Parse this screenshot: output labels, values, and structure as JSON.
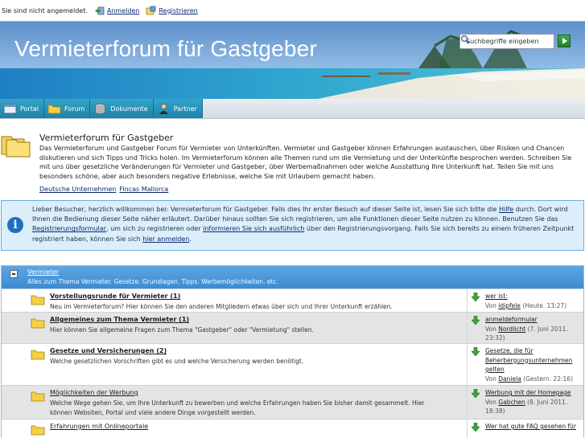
{
  "userbar": {
    "status": "Sie sind nicht angemeldet.",
    "login_label": "Anmelden",
    "register_label": "Registrieren"
  },
  "header": {
    "title": "Vermieterforum für Gastgeber",
    "search_placeholder": "Suchbegriffe eingeben"
  },
  "nav": {
    "tabs": [
      {
        "label": "Portal",
        "icon": "portal-icon"
      },
      {
        "label": "Forum",
        "icon": "folder-icon"
      },
      {
        "label": "Dokumente",
        "icon": "database-icon"
      },
      {
        "label": "Partner",
        "icon": "user-icon"
      }
    ]
  },
  "intro": {
    "title": "Vermieterforum für Gastgeber",
    "description": "Das Vermieterforum und Gastgeber Forum für Vermieter von Unterkünften. Vermieter und Gastgeber können Erfahrungen austauschen, über Risiken und Chancen diskutieren und sich Tipps und Tricks holen. Im Vermieterforum können alle Themen rund um die Vermietung und der Unterkünfte besprochen werden. Schreiben Sie mit uns über gesetzliche Veränderungen für Vermieter und Gastgeber, über Werbemaßnahmen oder welche Ausstattung Ihre Unterkunft hat. Teilen Sie mit uns besonders schöne, aber auch besonders negative Erlebnisse, welche Sie mit Urlaubern gemacht haben.",
    "links": [
      "Deutsche Unternehmen",
      "Fincas Mallorca"
    ]
  },
  "info": {
    "p1": "Lieber Besucher, herzlich willkommen bei: Vermieterforum für Gastgeber. Falls dies Ihr erster Besuch auf dieser Seite ist, lesen Sie sich bitte die ",
    "hilfe": "Hilfe",
    "p2": " durch. Dort wird Ihnen die Bedienung dieser Seite näher erläutert. Darüber hinaus sollten Sie sich registrieren, um alle Funktionen dieser Seite nutzen zu können. Benutzen Sie das ",
    "reg": "Registrierungsformular",
    "p3": ", um sich zu registrieren oder ",
    "inform": "informieren Sie sich ausführlich",
    "p4": " über den Registrierungsvorgang. Falls Sie sich bereits zu einem früheren Zeitpunkt registriert haben, können Sie sich ",
    "login": "hier anmelden",
    "p5": "."
  },
  "category": {
    "name": "Vermieter",
    "description": "Alles zum Thema Vermieter. Gesetze. Grundlagen. Tipps. Werbemöglichkeiten. etc."
  },
  "boards": [
    {
      "title": "Vorstellungsrunde für Vermieter (1)",
      "description": "Neu im Vermieterforum? Hier können Sie den anderen Mitgliedern etwas über sich und Ihrer Unterkunft erzählen.",
      "last_title": "wer ist:",
      "last_by_prefix": "Von ",
      "last_user": "idipfele",
      "last_time": " (Heute. 13:27)"
    },
    {
      "title": "Allgemeines zum Thema Vermieter (1)",
      "description": "Hier können Sie allgemeine Fragen zum Thema \"Gastgeber\" oder \"Vermietung\" stellen.",
      "last_title": "anmeldeformular",
      "last_by_prefix": "Von ",
      "last_user": "Nordlicht",
      "last_time": " (7. Juni 2011. 23:32)"
    },
    {
      "title": "Gesetze und Versicherungen (2)",
      "description": "Welche gesetzlichen Vorschriften gibt es und welche Versicherung werden benötigt.",
      "last_title": "Gesetze, die für Beherbergungsunternehmen gelten",
      "last_by_prefix": "Von ",
      "last_user": "Daniela",
      "last_time": " (Gestern. 22:16)"
    },
    {
      "title": "Möglichkeiten der Werbung",
      "description": "Welche Wege gehen Sie, um Ihre Unterkunft zu bewerben und welche Erfahrungen haben Sie bisher damit gesammelt. Hier können Websiten, Portal und viele andere Dinge vorgestellt werden.",
      "last_title": "Werbung mit der Homepage",
      "last_by_prefix": "Von ",
      "last_user": "Gabchen",
      "last_time": " (8. Juni 2011. 18:38)"
    },
    {
      "title": "Erfahrungen mit Onlineportale",
      "description": "",
      "last_title": "Wer hat gute FAQ gesehen für",
      "last_by_prefix": "",
      "last_user": "",
      "last_time": ""
    }
  ]
}
